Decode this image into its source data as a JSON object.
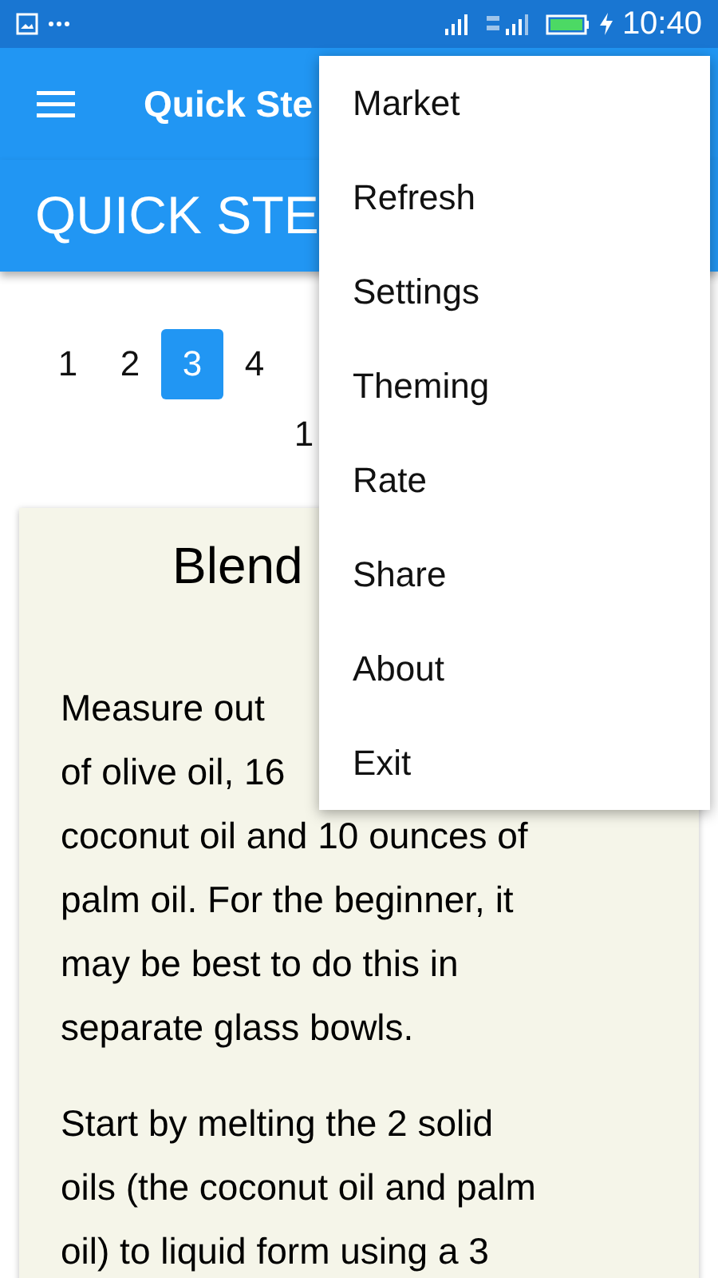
{
  "status_bar": {
    "time": "10:40"
  },
  "app_bar": {
    "title": "Quick Ste"
  },
  "header": {
    "title": "QUICK STE"
  },
  "pagination": {
    "pages": [
      {
        "label": "1",
        "selected": false
      },
      {
        "label": "2",
        "selected": false
      },
      {
        "label": "3",
        "selected": true
      },
      {
        "label": "4",
        "selected": false
      }
    ],
    "second_row": [
      "1"
    ]
  },
  "card": {
    "title": "Blend",
    "paragraphs": [
      {
        "lines": [
          "Measure out",
          "of olive oil, 16",
          "coconut oil and 10 ounces of",
          "palm oil. For the beginner, it",
          "may be best to do this in",
          "separate glass bowls."
        ]
      },
      {
        "lines": [
          "Start by melting the 2 solid",
          "oils (the coconut oil and palm",
          "oil) to liquid form using a 3"
        ]
      }
    ]
  },
  "menu": {
    "items": [
      "Market",
      "Refresh",
      "Settings",
      "Theming",
      "Rate",
      "Share",
      "About",
      "Exit"
    ]
  }
}
